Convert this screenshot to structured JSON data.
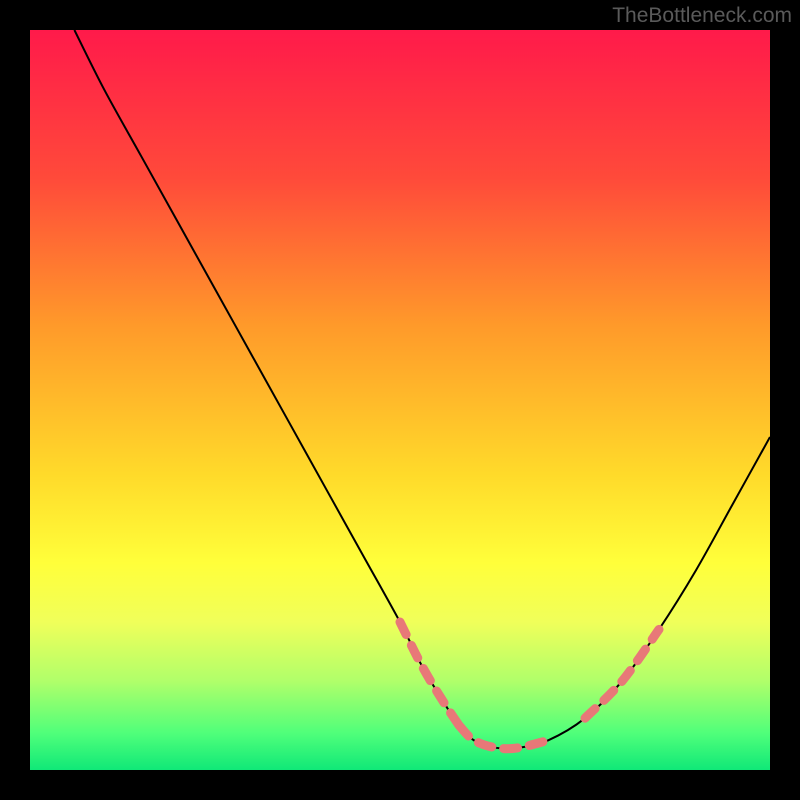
{
  "watermark": "TheBottleneck.com",
  "chart_data": {
    "type": "line",
    "title": "",
    "xlabel": "",
    "ylabel": "",
    "xlim": [
      0,
      100
    ],
    "ylim": [
      0,
      100
    ],
    "gradient_stops": [
      {
        "offset": 0,
        "color": "#ff1a4a"
      },
      {
        "offset": 20,
        "color": "#ff4a3a"
      },
      {
        "offset": 40,
        "color": "#ff9a2a"
      },
      {
        "offset": 60,
        "color": "#ffda2a"
      },
      {
        "offset": 72,
        "color": "#ffff3a"
      },
      {
        "offset": 80,
        "color": "#f0ff5a"
      },
      {
        "offset": 88,
        "color": "#b0ff6a"
      },
      {
        "offset": 95,
        "color": "#50ff7a"
      },
      {
        "offset": 100,
        "color": "#10e878"
      }
    ],
    "series": [
      {
        "name": "bottleneck-curve",
        "x": [
          6,
          10,
          15,
          20,
          25,
          30,
          35,
          40,
          45,
          50,
          53,
          56,
          58,
          60,
          63,
          66,
          70,
          75,
          80,
          85,
          90,
          95,
          100
        ],
        "y": [
          100,
          92,
          83,
          74,
          65,
          56,
          47,
          38,
          29,
          20,
          14,
          9,
          6,
          4,
          3,
          3,
          4,
          7,
          12,
          19,
          27,
          36,
          45
        ]
      }
    ],
    "dash_segments": {
      "left": {
        "x_range": [
          50,
          58
        ],
        "desc": "left descending dashed pink"
      },
      "bottom": {
        "x_range": [
          58,
          70
        ],
        "desc": "valley dashed pink"
      },
      "right": {
        "x_range": [
          75,
          85
        ],
        "desc": "right ascending dashed pink"
      }
    },
    "dash_color": "#e87878",
    "curve_color": "#000000"
  }
}
